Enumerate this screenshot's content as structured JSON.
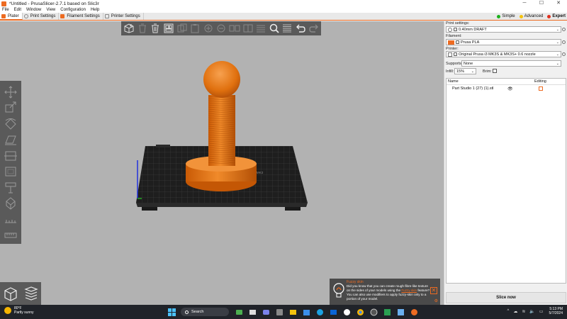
{
  "window": {
    "title": "*Untitled - PrusaSlicer-2.7.1 based on Slic3r",
    "minimize": "─",
    "maximize": "☐",
    "close": "✕"
  },
  "menu": [
    "File",
    "Edit",
    "Window",
    "View",
    "Configuration",
    "Help"
  ],
  "tabs": [
    {
      "label": "Plater",
      "active": true
    },
    {
      "label": "Print Settings"
    },
    {
      "label": "Filament Settings"
    },
    {
      "label": "Printer Settings"
    }
  ],
  "modes": [
    {
      "label": "Simple",
      "color": "#1cb01c"
    },
    {
      "label": "Advanced",
      "color": "#f4c20d"
    },
    {
      "label": "Expert",
      "color": "#e0301e"
    }
  ],
  "top_toolbar": [
    "add-icon",
    "delete-icon",
    "delete-all-icon",
    "arrange-icon",
    "copy-icon",
    "paste-icon",
    "add-instance-icon",
    "remove-instance-icon",
    "split-objects-icon",
    "split-parts-icon",
    "variable-layer-height-icon",
    "search-icon",
    "layers-icon",
    "undo-icon"
  ],
  "left_toolbar": [
    "move-icon",
    "scale-icon",
    "rotate-icon",
    "place-on-face-icon",
    "cut-icon",
    "hollow-icon",
    "support-points-icon",
    "fdm-supports-icon",
    "seam-icon",
    "measure-icon"
  ],
  "bed": {
    "label": "ORIGINAL PRUSA i3 MK3"
  },
  "right_panel": {
    "print_settings_label": "Print settings:",
    "print_settings_value": "0.40mm DRAFT",
    "filament_label": "Filament:",
    "filament_value": "Prusa PLA",
    "filament_color": "#ed6b21",
    "printer_label": "Printer:",
    "printer_value": "Original Prusa i3 MK3S & MK3S+ 0.6 nozzle",
    "supports_label": "Supports:",
    "supports_value": "None",
    "infill_label": "Infill:",
    "infill_value": "15%",
    "brim_label": "Brim:",
    "col_name": "Name",
    "col_editing": "Editing",
    "object_name": "Part Studio 1 (27) (1).stl",
    "slice_button": "Slice now"
  },
  "notification": {
    "title": "Fuzzy skin",
    "body_prefix": "Did you know that you can create rough fibre-like texture on the sides of your models using the ",
    "link": "Fuzzy skin",
    "body_suffix": " feature? You can also use modifiers to apply fuzzy-skin only to a portion of your model."
  },
  "taskbar": {
    "temp": "80°F",
    "weather": "Partly sunny",
    "search_placeholder": "Search",
    "time": "5:13 PM",
    "date": "5/7/2024"
  },
  "colors": {
    "accent": "#ed6b21",
    "model": "#e8730c",
    "viewport": "#b2b2b2",
    "toolbar": "#5a5a5a"
  }
}
